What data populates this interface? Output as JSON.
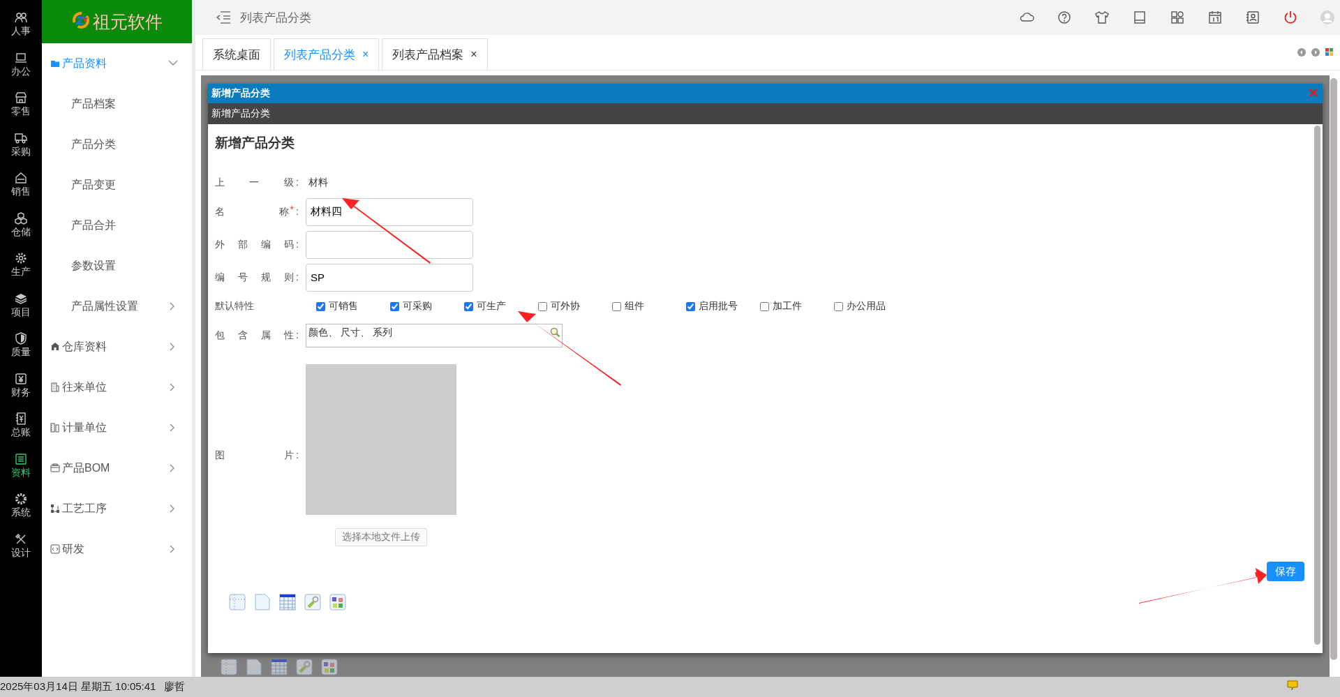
{
  "logo": {
    "text": "祖元软件"
  },
  "rail": [
    {
      "label": "人事",
      "selected": false
    },
    {
      "label": "办公",
      "selected": false
    },
    {
      "label": "零售",
      "selected": false
    },
    {
      "label": "采购",
      "selected": false
    },
    {
      "label": "销售",
      "selected": false
    },
    {
      "label": "仓储",
      "selected": false
    },
    {
      "label": "生产",
      "selected": false
    },
    {
      "label": "项目",
      "selected": false
    },
    {
      "label": "质量",
      "selected": false
    },
    {
      "label": "财务",
      "selected": false
    },
    {
      "label": "总账",
      "selected": false
    },
    {
      "label": "资料",
      "selected": true
    },
    {
      "label": "系统",
      "selected": false
    },
    {
      "label": "设计",
      "selected": false
    }
  ],
  "sidebar": {
    "items": [
      {
        "label": "产品资料",
        "expanded": true,
        "children": [
          {
            "label": "产品档案",
            "has_children": false
          },
          {
            "label": "产品分类",
            "has_children": false
          },
          {
            "label": "产品变更",
            "has_children": false
          },
          {
            "label": "产品合并",
            "has_children": false
          },
          {
            "label": "参数设置",
            "has_children": false
          },
          {
            "label": "产品属性设置",
            "has_children": true
          }
        ]
      },
      {
        "label": "仓库资料",
        "expanded": false
      },
      {
        "label": "往来单位",
        "expanded": false
      },
      {
        "label": "计量单位",
        "expanded": false
      },
      {
        "label": "产品BOM",
        "expanded": false
      },
      {
        "label": "工艺工序",
        "expanded": false
      },
      {
        "label": "研发",
        "expanded": false
      }
    ]
  },
  "header": {
    "title": "列表产品分类"
  },
  "tabs": [
    {
      "label": "系统桌面",
      "selected": false,
      "closable": false
    },
    {
      "label": "列表产品分类",
      "selected": true,
      "closable": true
    },
    {
      "label": "列表产品档案",
      "selected": false,
      "closable": true
    }
  ],
  "tab_close_glyph": "×",
  "dialog": {
    "window_title": "新增产品分类",
    "subtitle": "新增产品分类",
    "heading": "新增产品分类",
    "label_suffix": ":",
    "required_mark": "*",
    "fields": [
      {
        "kind": "static",
        "label": "上 一 级",
        "required": false,
        "value": "材料"
      },
      {
        "kind": "input",
        "label": "名 称",
        "required": true,
        "value": "材料四"
      },
      {
        "kind": "input",
        "label": "外 部 编 码",
        "required": false
      },
      {
        "kind": "input",
        "label": "编 号 规 则",
        "required": false,
        "value": "SP"
      },
      {
        "kind": "checks",
        "label": "默认特性",
        "options": [
          {
            "label": "可销售",
            "checked": true
          },
          {
            "label": "可采购",
            "checked": true
          },
          {
            "label": "可生产",
            "checked": true
          },
          {
            "label": "可外协",
            "checked": false
          },
          {
            "label": "组件",
            "checked": false
          },
          {
            "label": "启用批号",
            "checked": true
          },
          {
            "label": "加工件",
            "checked": false
          },
          {
            "label": "办公用品",
            "checked": false
          }
        ]
      },
      {
        "kind": "lookup",
        "label": "包 含 属 性",
        "required": false,
        "value": "颜色、 尺寸、 系列"
      },
      {
        "kind": "image",
        "label": "图 片",
        "required": false,
        "upload_button": "选择本地文件上传"
      }
    ],
    "save_button": "保存"
  },
  "status_bar": {
    "datetime": "2025年03月14日 星期五 10:05:41",
    "user": "廖哲"
  }
}
